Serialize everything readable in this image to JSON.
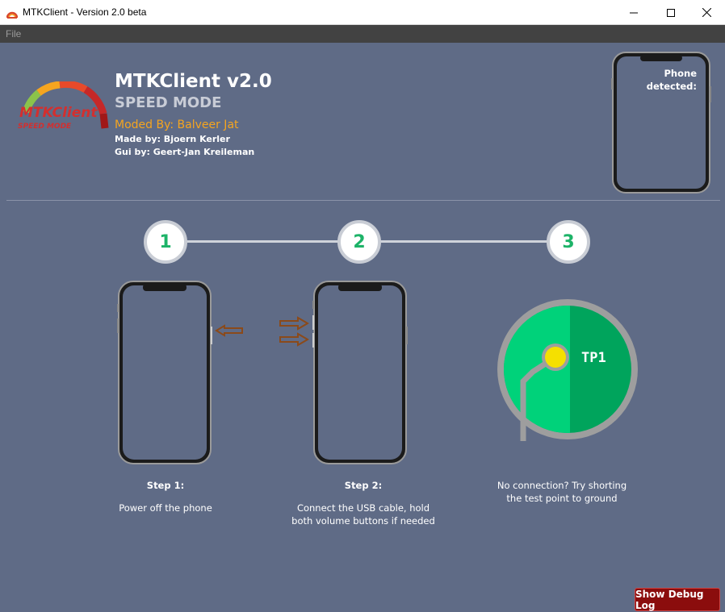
{
  "window": {
    "title": "MTKClient - Version 2.0 beta",
    "icon": "mtkclient-app-icon",
    "controls": [
      "minimize-icon",
      "maximize-icon",
      "close-icon"
    ]
  },
  "menubar": {
    "file_label": "File"
  },
  "header": {
    "logo_text": "MTKClient",
    "logo_subtext": "SPEED MODE",
    "title": "MTKClient v2.0",
    "subtitle": "SPEED MODE",
    "moded_by": "Moded By: Balveer Jat",
    "made_by": "Made by: Bjoern Kerler",
    "gui_by": "Gui by: Geert-Jan Kreileman",
    "phone_status": "Phone detected:"
  },
  "steps": [
    {
      "number": "1",
      "title": "Step 1:",
      "description": "Power off the phone"
    },
    {
      "number": "2",
      "title": "Step 2:",
      "description": "Connect the USB cable, hold both volume buttons if needed"
    },
    {
      "number": "3",
      "title": "",
      "description": "No connection? Try shorting the test point to ground"
    }
  ],
  "testpoint": {
    "label": "TP1"
  },
  "debug_button": {
    "label": "Show Debug Log"
  },
  "colors": {
    "background": "#5f6b86",
    "step_number": "#1db368",
    "moded_by": "#f5a51f",
    "debug_button": "#8b0d0d",
    "tp_green": "#00d27a",
    "tp_dark_green": "#00a45c",
    "tp_dot": "#f5e000"
  }
}
